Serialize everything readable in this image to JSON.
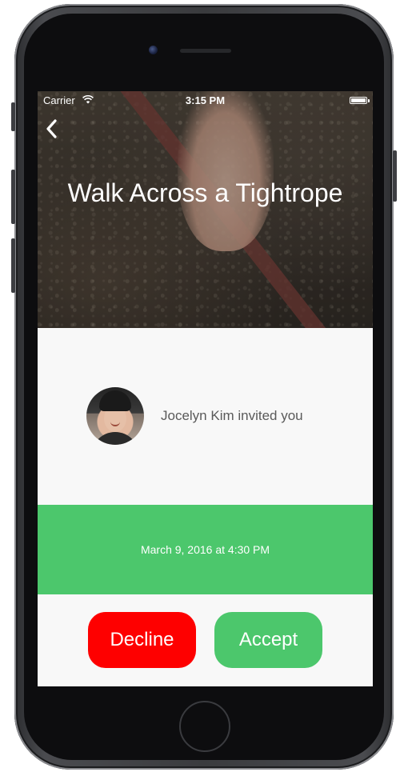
{
  "status_bar": {
    "carrier": "Carrier",
    "time": "3:15 PM",
    "wifi_icon": "wifi-icon",
    "battery_icon": "battery-full-icon"
  },
  "nav": {
    "back_icon": "chevron-left-icon"
  },
  "event": {
    "title": "Walk Across a Tightrope",
    "hero_image": "hand holding tightrope photo"
  },
  "invite": {
    "avatar": "Jocelyn Kim avatar",
    "text": "Jocelyn Kim invited you"
  },
  "date": {
    "text": "March 9, 2016 at 4:30 PM"
  },
  "actions": {
    "decline_label": "Decline",
    "accept_label": "Accept"
  },
  "colors": {
    "accent_green": "#4cc76c",
    "decline_red": "#fe0000",
    "background": "#f8f8f8"
  }
}
